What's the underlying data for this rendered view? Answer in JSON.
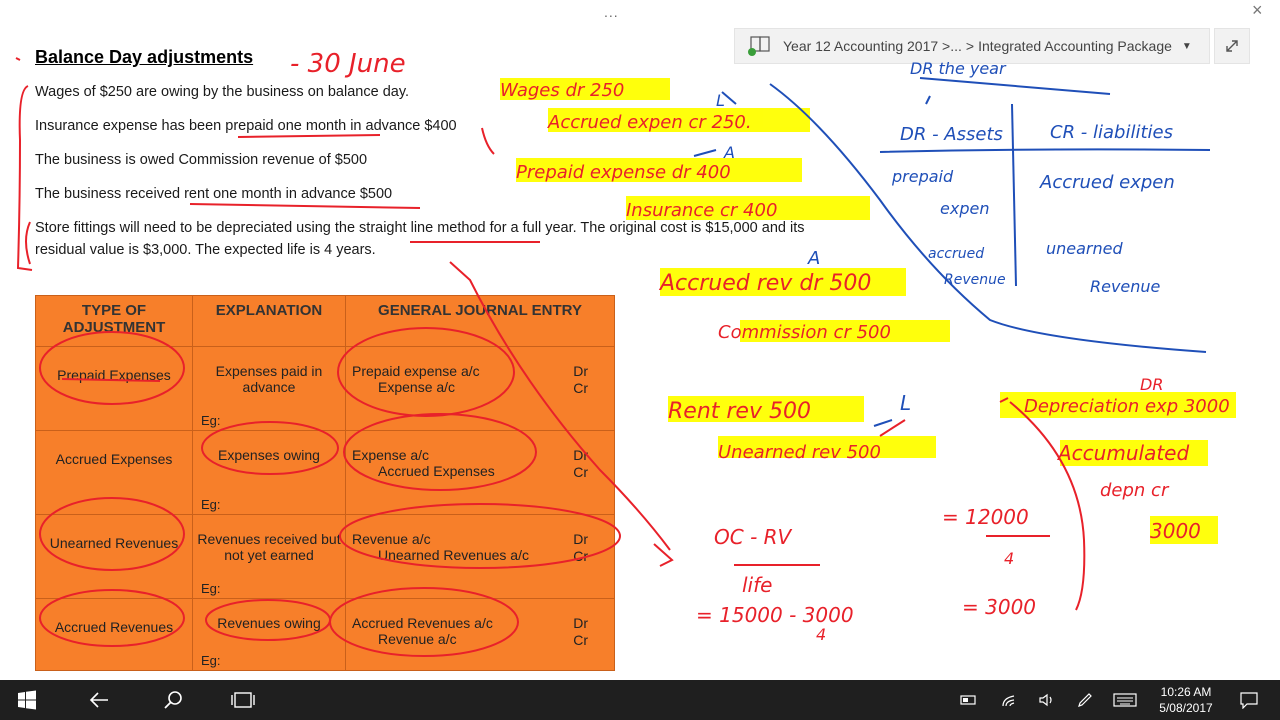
{
  "window": {
    "menu_dots": "...",
    "close": "×"
  },
  "notebook_bar": {
    "notebook": "Year 12 Accounting 2017 >...",
    "separator": ">",
    "page": "Integrated Accounting Package"
  },
  "slide": {
    "title": "Balance Day adjustments",
    "statements": [
      "Wages of $250 are owing by the business on balance day.",
      "Insurance expense has been prepaid one month in advance $400",
      "The business is owed Commission revenue of $500",
      "The business received rent one month in advance $500",
      "Store fittings will need to be depreciated using the straight line method for a full year. The original cost is $15,000 and its",
      "residual value is $3,000. The expected life is 4 years."
    ]
  },
  "table": {
    "headers": [
      "TYPE OF ADJUSTMENT",
      "EXPLANATION",
      "GENERAL JOURNAL ENTRY"
    ],
    "eg_label": "Eg:",
    "rows": [
      {
        "type": "Prepaid Expenses",
        "explanation": "Expenses paid in advance",
        "entry1": "Prepaid expense a/c",
        "entry2": "Expense a/c",
        "dr": "Dr",
        "cr": "Cr"
      },
      {
        "type": "Accrued Expenses",
        "explanation": "Expenses owing",
        "entry1": "Expense a/c",
        "entry2": "Accrued Expenses",
        "dr": "Dr",
        "cr": "Cr"
      },
      {
        "type": "Unearned Revenues",
        "explanation": "Revenues received but not yet earned",
        "entry1": "Revenue a/c",
        "entry2": "Unearned Revenues a/c",
        "dr": "Dr",
        "cr": "Cr"
      },
      {
        "type": "Accrued Revenues",
        "explanation": "Revenues owing",
        "entry1": "Accrued Revenues a/c",
        "entry2": "Revenue a/c",
        "dr": "Dr",
        "cr": "Cr"
      }
    ]
  },
  "handwriting": {
    "date_note": "- 30 June",
    "wages": "Wages dr 250",
    "accrued_exp": "Accrued expen cr 250.",
    "L1": "L",
    "A1": "A",
    "prepaid": "Prepaid expense dr 400",
    "insurance": "Insurance cr 400",
    "A2": "A",
    "accrued_rev": "Accrued rev dr 500",
    "commission": "Commission cr 500",
    "rent": "Rent rev 500",
    "L2": "L",
    "unearned": "Unearned rev 500",
    "dr_label": "DR",
    "depreciation": "Depreciation exp 3000",
    "accum1": "Accumulated",
    "accum2": "depn cr",
    "accum3": "3000",
    "formula_top": "OC - RV",
    "formula_bottom": "life",
    "calc1": "= 15000 - 3000",
    "calc1_div": "4",
    "calc2": "= 12000",
    "calc2_div": "4",
    "calc3": "= 3000",
    "t_top": "DR the year",
    "t_dr": "DR - Assets",
    "t_cr": "CR - liabilities",
    "t_prepaid1": "prepaid",
    "t_prepaid2": "expen",
    "t_accrued1": "accrued",
    "t_accrued2": "Revenue",
    "t_accexp": "Accrued expen",
    "t_unearned1": "unearned",
    "t_unearned2": "Revenue"
  },
  "taskbar": {
    "time": "10:26 AM",
    "date": "5/08/2017"
  },
  "colors": {
    "table_bg": "#f77f2a",
    "ink_red": "#e8212a",
    "ink_blue": "#1f4fb8",
    "highlight": "#ffff00"
  }
}
